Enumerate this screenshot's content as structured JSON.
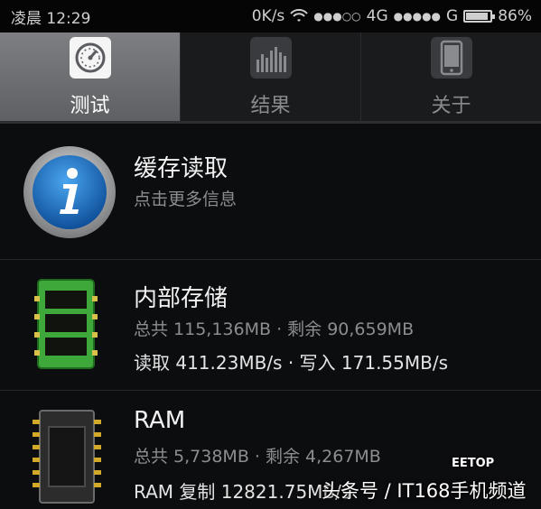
{
  "status_bar": {
    "time": "凌晨 12:29",
    "network_speed": "0K/s",
    "signal1": "●●●○○",
    "carrier1": "4G",
    "signal2": "●●●●●",
    "carrier2": "G",
    "battery": "86%",
    "battery_level": 0.86
  },
  "tabs": [
    {
      "label": "测试",
      "icon": "speedometer-icon",
      "active": true
    },
    {
      "label": "结果",
      "icon": "bar-chart-icon",
      "active": false
    },
    {
      "label": "关于",
      "icon": "phone-icon",
      "active": false
    }
  ],
  "items": [
    {
      "title": "缓存读取",
      "subtitle": "点击更多信息",
      "icon": "info-icon"
    },
    {
      "title": "内部存储",
      "subtitle": "总共 115,136MB · 剩余 90,659MB",
      "speed": "读取 411.23MB/s · 写入 171.55MB/s",
      "icon": "sd-card-icon"
    },
    {
      "title": "RAM",
      "subtitle": "总共 5,738MB · 剩余 4,267MB",
      "speed": "RAM 复制 12821.75MB/s",
      "icon": "chip-icon"
    }
  ],
  "watermark": {
    "text": "头条号 / IT168手机频道",
    "logo": "EETOP"
  },
  "colors": {
    "background": "#0c0d0f",
    "active_tab": "#6e7074",
    "info_blue": "#1c78c8",
    "sd_green": "#3fa83a"
  }
}
